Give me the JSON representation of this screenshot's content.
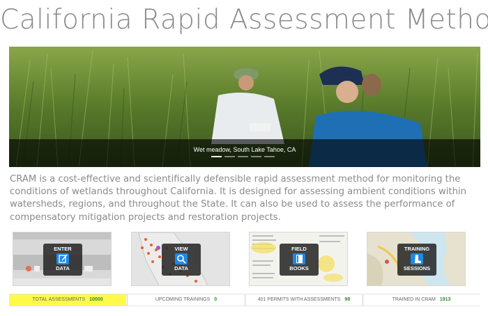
{
  "page": {
    "title": "California Rapid Assessment Method"
  },
  "hero": {
    "caption": "Wet meadow, South Lake Tahoe, CA",
    "slide_count": 5,
    "active_slide": 1
  },
  "intro": {
    "text": "CRAM is a cost-effective and scientifically defensible rapid assessment method for monitoring the conditions of wetlands throughout California. It is designed for assessing ambient conditions within watersheds, regions, and throughout the State. It can also be used to assess the performance of compensatory mitigation projects and restoration projects."
  },
  "tiles": [
    {
      "line1": "ENTER",
      "line2": "DATA",
      "icon": "edit-icon"
    },
    {
      "line1": "VIEW",
      "line2": "DATA",
      "icon": "magnifier-icon"
    },
    {
      "line1": "FIELD",
      "line2": "BOOKS",
      "icon": "book-icon"
    },
    {
      "line1": "TRAINING",
      "line2": "SESSIONS",
      "icon": "boot-icon"
    }
  ],
  "stats": [
    {
      "label": "TOTAL ASSESSMENTS",
      "value": "10000"
    },
    {
      "label": "UPCOMING TRAININGS",
      "value": "0"
    },
    {
      "label": "401 PERMITS WITH ASSESSMENTS",
      "value": "98"
    },
    {
      "label": "TRAINED IN CRAM",
      "value": "1913"
    }
  ],
  "colors": {
    "title": "#8a8a8a",
    "stat_value": "#2e8b2e",
    "highlight": "#fffa4a",
    "icon_blue": "#1e88e5"
  }
}
